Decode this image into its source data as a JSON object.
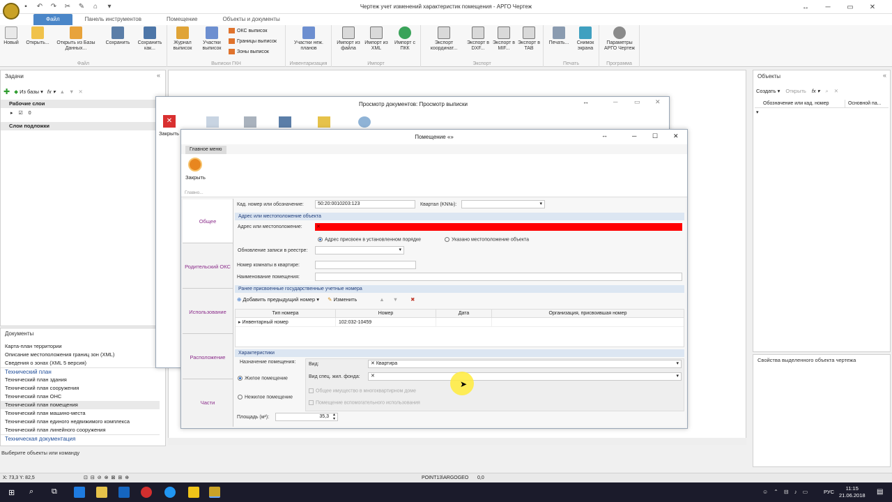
{
  "app": {
    "title": "Чертеж учет изменений характеристик помещения - АРГО Чертеж"
  },
  "tabs": [
    "Файл",
    "Панель инструментов",
    "Помещение",
    "Объекты и документы"
  ],
  "ribbon": {
    "buttons": [
      {
        "label": "Новый",
        "icon": "new-doc-icon"
      },
      {
        "label": "Открыть...",
        "icon": "open-folder-icon"
      },
      {
        "label": "Открыть из Базы Данных...",
        "icon": "open-db-icon"
      },
      {
        "label": "Сохранить",
        "icon": "save-icon"
      },
      {
        "label": "Сохранить как...",
        "icon": "save-as-icon"
      },
      {
        "label": "Журнал выписок",
        "icon": "journal-icon"
      },
      {
        "label": "Участки выписок",
        "icon": "parcels-icon"
      },
      {
        "label": "Участки неж. планов",
        "icon": "grid-icon"
      },
      {
        "label": "Импорт из файла",
        "icon": "import-file-icon"
      },
      {
        "label": "Импорт из XML",
        "icon": "import-xml-icon"
      },
      {
        "label": "Импорт с ПКК",
        "icon": "import-globe-icon"
      },
      {
        "label": "Экспорт координат...",
        "icon": "export-coords-icon"
      },
      {
        "label": "Экспорт в DXF...",
        "icon": "export-dxf-icon"
      },
      {
        "label": "Экспорт в MIF...",
        "icon": "export-mif-icon"
      },
      {
        "label": "Экспорт в TAB",
        "icon": "export-tab-icon"
      },
      {
        "label": "Печать...",
        "icon": "print-icon"
      },
      {
        "label": "Снимок экрана",
        "icon": "screenshot-icon"
      },
      {
        "label": "Параметры АРГО Чертеж",
        "icon": "gear-icon"
      }
    ],
    "small": [
      "ОКС выписок",
      "Границы выписок",
      "Зоны выписок"
    ],
    "groups": [
      "Файл",
      "Выписки ГКН",
      "Инвентаризация",
      "Импорт",
      "Экспорт",
      "Печать",
      "Программа"
    ]
  },
  "left": {
    "title": "Задачи",
    "toolbar_db": "Из базы",
    "layers_title": "Рабочие слои",
    "layer_value": "0",
    "underlay_title": "Слои подложки",
    "docs_title": "Документы",
    "docs_items": [
      {
        "t": "Карта-план территории",
        "h": false
      },
      {
        "t": "Описание местоположения границ зон (XML)",
        "h": false
      },
      {
        "t": "Сведения о зонах (XML 5 версия)",
        "h": false
      },
      {
        "t": "Технический план",
        "h": true
      },
      {
        "t": "Технический план здания",
        "h": false
      },
      {
        "t": "Технический план сооружения",
        "h": false
      },
      {
        "t": "Технический план ОНС",
        "h": false
      },
      {
        "t": "Технический план помещения",
        "h": false
      },
      {
        "t": "Технический план машино-места",
        "h": false
      },
      {
        "t": "Технический план единого недвижимого комплекса",
        "h": false
      },
      {
        "t": "Технический план линейного сооружения",
        "h": false
      },
      {
        "t": "Техническая документация",
        "h": true
      }
    ],
    "command_hint": "Выберите объекты или команду"
  },
  "right": {
    "title": "Объекты",
    "create": "Создать",
    "open": "Открыть",
    "col1": "Обозначение или кад. номер",
    "col2": "Основной па...",
    "props_title": "Свойства выделенного объекта чертежа"
  },
  "docview": {
    "title": "Просмотр документов: Просмотр выписки",
    "close": "Закрыть"
  },
  "dialog": {
    "title": "Помещение «»",
    "menu_tab": "Главное меню",
    "close": "Закрыть",
    "group": "Главно...",
    "nav": [
      "Общее",
      "Родительский ОКС",
      "Использование",
      "Расположение",
      "Части"
    ],
    "cad_label": "Кад. номер или обозначение:",
    "cad_value": "50:20:0010203:123",
    "kvartal_label": "Квартал (KN№):",
    "addr_section": "Адрес или местоположение объекта",
    "addr_label": "Адрес или местоположение:",
    "radio1": "Адрес присвоен в установленном порядке",
    "radio2": "Указано местоположение объекта",
    "update_label": "Обновление записи в реестре:",
    "room_label": "Номер комнаты в квартире:",
    "name_label": "Наименование помещения:",
    "prev_section": "Ранее присвоенные государственные учетные номера",
    "add_prev": "Добавить предыдущий номер",
    "edit": "Изменить",
    "table_headers": [
      "Тип номера",
      "Номер",
      "Дата",
      "Организация, присвоившая номер"
    ],
    "table_row": [
      "Инвентарный номер",
      "102:032-10459",
      "",
      ""
    ],
    "char_section": "Характеристики",
    "purpose_label": "Назначение помещения:",
    "living": "Жилое помещение",
    "nonliving": "Нежилое помещение",
    "vid_label": "Вид:",
    "vid_value": "Квартира",
    "spec_label": "Вид спец. жил. фонда:",
    "chk1": "Общее имущество в многоквартирном доме",
    "chk2": "Помещение вспомогательного использования",
    "area_label": "Площадь (м²):",
    "area_value": "35,3"
  },
  "status": {
    "coords": "X: 73,3 Y: 82,5",
    "snap": "POINT13\\ARGOGEO",
    "value": "0,0"
  },
  "taskbar": {
    "lang": "РУС",
    "time": "11:15",
    "date": "21.06.2018"
  },
  "colors": {
    "accent": "#4a86c8",
    "address_error": "#ff0000",
    "highlight": "#ffeb3b"
  }
}
